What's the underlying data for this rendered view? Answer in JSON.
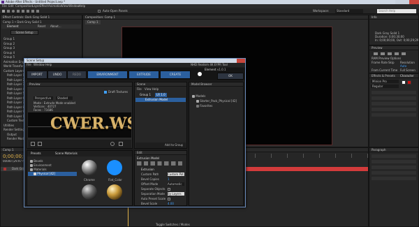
{
  "ae": {
    "title": "Adobe After Effects - Untitled Project.aep *",
    "menu": [
      "File",
      "Edit",
      "Composition",
      "Layer",
      "Effect",
      "Animation",
      "View",
      "Window",
      "Help"
    ],
    "toolbar_right": "Auto-Open Panels",
    "workspace_label": "Workspace:",
    "workspace_value": "Standard",
    "search_placeholder": "Search Help",
    "left_tab": "Effect Controls: Dark Gray Solid 1",
    "left_sub": "Comp 1 • Dark Gray Solid 1",
    "left_fx": "Element",
    "reset_label": "Reset",
    "about_label": "About...",
    "scene_setup": "Scene Setup",
    "left_groups": [
      "Group 1",
      "Group 2",
      "Group 3",
      "Group 4",
      "Group 5",
      "Animation Eng...",
      "World Transform",
      "Custom Layers",
      "Path Layer 1",
      "Path Layer 2",
      "Path Layer 3",
      "Path Layer 4",
      "Path Layer 5",
      "Path Layer 6",
      "Path Layer 7",
      "Path Layer 8",
      "Path Layer 9",
      "Path Layer 10",
      "Custom Text...",
      "Utilities",
      "Render Settings",
      "Output",
      "Render Mode"
    ],
    "comp_tab": "Composition: Comp 1",
    "comp_sub": "Comp 1",
    "timeline_tab": "Comp 1",
    "timecode": "0;00;00;00",
    "timecode_sub": "00000 (29.97 fps)",
    "layer_name": "Dark Gray Solid 1",
    "bottom_status": "Toggle Switches / Modes",
    "right_info_tab": "Info",
    "right_info": [
      "Dark Gray Solid 1",
      "Duration: 0;00;30;00",
      "In: 0;00;00;00, Out: 0;00;29;29"
    ],
    "preview_tab": "Preview",
    "ram_preview": "RAM Preview Options",
    "frame_rate": "Frame Rate",
    "skip": "Skip",
    "resolution": "Resolution",
    "auto": "Auto",
    "from_current": "From Current Time",
    "full_screen": "Full Screen",
    "effects_tab": "Effects & Presets",
    "character_tab": "Character",
    "font_name": "Minion Pro",
    "font_style": "Regular",
    "paragraph_tab": "Paragraph"
  },
  "dialog": {
    "title": "Scene Setup",
    "menu": [
      "File",
      "Window",
      "Help"
    ],
    "brand": "NHD Realism 4K EYPR Tool",
    "element_label": "Element",
    "element_version": "v1.0.1",
    "toolbar": {
      "import": "IMPORT",
      "undo": "UNDO",
      "redo": "REDO",
      "environment": "ENVIRONMENT",
      "extrude": "EXTRUDE",
      "create": "CREATE",
      "ok": "OK"
    },
    "preview": {
      "tab": "Preview",
      "draft_label": "Draft Textures",
      "perspective": "Perspective",
      "shaded": "Shaded",
      "info": [
        "Mode : Extrude Mode enabled",
        "Vertices : 40727",
        "Faces : 71686"
      ],
      "watermark": "CWER.WS"
    },
    "scene": {
      "tab": "Scene",
      "menu": [
        "File",
        "View",
        "Help"
      ],
      "group_label": "Group 1",
      "group_badge": "LR 1.0",
      "model_label": "Extrusion Model",
      "add_group": "Add to Group"
    },
    "model_browser": {
      "tab": "Model Browser",
      "items": [
        "Models",
        "Starter_Pack_Physical [42]",
        "Favorites"
      ]
    },
    "presets": {
      "tab": "Presets",
      "materials_tab": "Scene Materials",
      "items": [
        "Bevels",
        "Environment",
        "Materials",
        "Physical [42]"
      ],
      "materials": [
        "Chrome",
        "Flat_Color"
      ]
    },
    "edit": {
      "tab": "Edit",
      "section": "Extrusion Model",
      "subsection": "Extrusion",
      "props": [
        {
          "name": "Custom Path",
          "value": "Custom Pat..."
        },
        {
          "name": "Bevel Copies",
          "value": "1"
        },
        {
          "name": "Offset Mode",
          "value": "Automatic"
        },
        {
          "name": "Separate Objects",
          "value": ""
        },
        {
          "name": "Separation Mode",
          "value": "By Layers"
        },
        {
          "name": "Auto Preset Scale",
          "value": ""
        },
        {
          "name": "Bevel Scale",
          "value": "4.00"
        }
      ]
    }
  },
  "colors": {
    "accent_blue": "#2f8fe8",
    "ae_red": "#d23b3b",
    "flat_blue": "#1a8fff"
  }
}
